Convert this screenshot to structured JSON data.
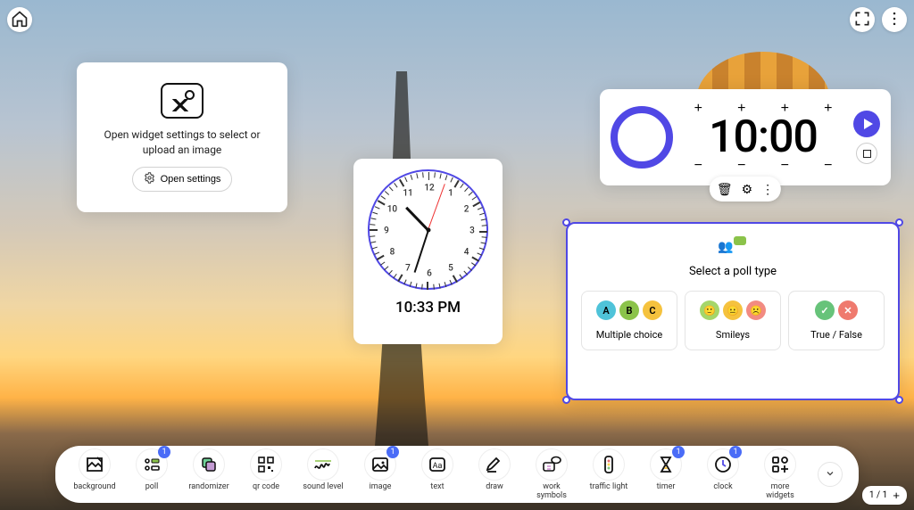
{
  "top": {
    "home": "home-icon",
    "fullscreen": "fullscreen-icon",
    "more": "more-icon"
  },
  "imageWidget": {
    "message_line1": "Open widget settings to select or",
    "message_line2": "upload an image",
    "settings_label": "Open settings"
  },
  "clockWidget": {
    "time_text": "10:33 PM",
    "numerals": [
      "12",
      "1",
      "2",
      "3",
      "4",
      "5",
      "6",
      "7",
      "8",
      "9",
      "10",
      "11"
    ]
  },
  "timerWidget": {
    "value": "10:00"
  },
  "pollWidget": {
    "title": "Select a poll type",
    "options": [
      {
        "label": "Multiple choice",
        "letters": [
          "A",
          "B",
          "C"
        ],
        "colors": [
          "#4fc3d9",
          "#8bc34a",
          "#f5c23e"
        ]
      },
      {
        "label": "Smileys",
        "emojis": [
          "🙂",
          "😐",
          "☹️"
        ],
        "colors": [
          "#a5d66a",
          "#f5c23e",
          "#f28b82"
        ]
      },
      {
        "label": "True / False",
        "emojis": [
          "✓",
          "✕"
        ],
        "colors": [
          "#67c37a",
          "#ef7a6e"
        ]
      }
    ]
  },
  "toolbar": {
    "items": [
      {
        "label": "background",
        "badge": null,
        "icon": "background"
      },
      {
        "label": "poll",
        "badge": "1",
        "icon": "poll"
      },
      {
        "label": "randomizer",
        "badge": null,
        "icon": "randomizer"
      },
      {
        "label": "qr code",
        "badge": null,
        "icon": "qrcode"
      },
      {
        "label": "sound level",
        "badge": null,
        "icon": "sound"
      },
      {
        "label": "image",
        "badge": "1",
        "icon": "image"
      },
      {
        "label": "text",
        "badge": null,
        "icon": "text"
      },
      {
        "label": "draw",
        "badge": null,
        "icon": "draw"
      },
      {
        "label": "work symbols",
        "badge": null,
        "icon": "worksymbols"
      },
      {
        "label": "traffic light",
        "badge": null,
        "icon": "trafficlight"
      },
      {
        "label": "timer",
        "badge": "1",
        "icon": "timer"
      },
      {
        "label": "clock",
        "badge": "1",
        "icon": "clock"
      },
      {
        "label": "more widgets",
        "badge": null,
        "icon": "more"
      }
    ]
  },
  "pageIndicator": {
    "text": "1 / 1",
    "add": "+"
  }
}
